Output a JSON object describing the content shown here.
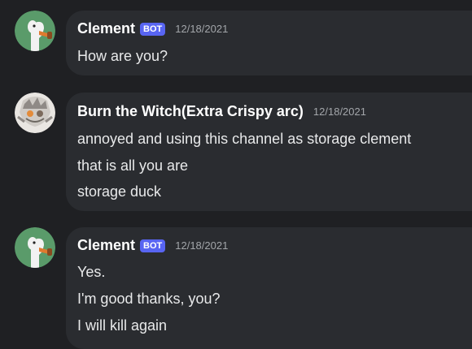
{
  "messages": [
    {
      "author": "Clement",
      "avatar": "goose-avatar",
      "badge": "BOT",
      "timestamp": "12/18/2021",
      "lines": [
        "How are you?"
      ]
    },
    {
      "author": "Burn the Witch(Extra Crispy arc)",
      "avatar": "character-avatar",
      "badge": "",
      "timestamp": "12/18/2021",
      "lines": [
        "annoyed and using this channel as storage clement",
        "that is all you are",
        "storage duck"
      ]
    },
    {
      "author": "Clement",
      "avatar": "goose-avatar",
      "badge": "BOT",
      "timestamp": "12/18/2021",
      "lines": [
        "Yes.",
        "I'm good thanks, you?",
        "I will kill again"
      ]
    }
  ],
  "colors": {
    "background": "#1f2023",
    "bubble": "#2a2c30",
    "bot_badge": "#5865f2",
    "goose_avatar_bg": "#5a9b6a"
  }
}
